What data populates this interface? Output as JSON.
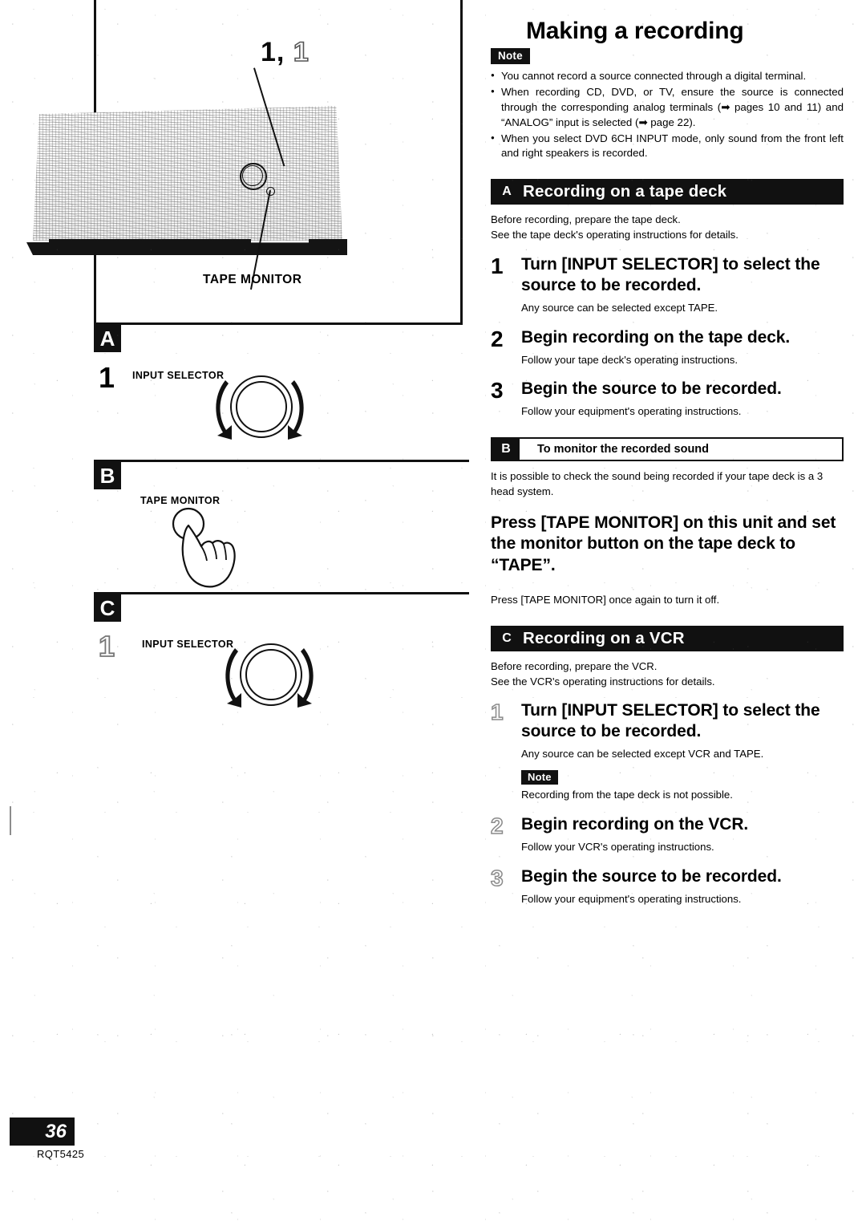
{
  "document": {
    "title": "Making a recording",
    "page_number": "36",
    "doc_code": "RQT5425"
  },
  "illustration": {
    "callout_step_solid": "1,",
    "callout_step_hollow": "1",
    "knob_caption": "TAPE MONITOR"
  },
  "left_diagrams": [
    {
      "badge": "A",
      "step_number": "1",
      "step_style": "solid",
      "control_label": "INPUT SELECTOR",
      "control_type": "rotary-knob"
    },
    {
      "badge": "B",
      "step_number": "",
      "step_style": "none",
      "control_label": "TAPE MONITOR",
      "control_type": "push-button-hand"
    },
    {
      "badge": "C",
      "step_number": "1",
      "step_style": "hollow",
      "control_label": "INPUT SELECTOR",
      "control_type": "rotary-knob"
    }
  ],
  "note_top": {
    "badge": "Note",
    "items": [
      "You cannot record a source connected through a digital terminal.",
      "When recording CD, DVD, or TV, ensure the source is connected through the corresponding analog terminals (➡ pages 10 and 11) and “ANALOG” input is selected (➡ page 22).",
      "When you select DVD 6CH INPUT mode, only sound from the front left and right speakers is recorded."
    ]
  },
  "section_a": {
    "letter": "A",
    "title": "Recording on a tape deck",
    "lead": [
      "Before recording, prepare the tape deck.",
      "See the tape deck's operating instructions for details."
    ],
    "steps": [
      {
        "num": "1",
        "style": "solid",
        "head": "Turn [INPUT SELECTOR] to select the source to be recorded.",
        "sub": "Any source can be selected except TAPE."
      },
      {
        "num": "2",
        "style": "solid",
        "head": "Begin recording on the tape deck.",
        "sub": "Follow your tape deck's operating instructions."
      },
      {
        "num": "3",
        "style": "solid",
        "head": "Begin the source to be recorded.",
        "sub": "Follow your equipment's operating instructions."
      }
    ]
  },
  "section_b": {
    "letter": "B",
    "title": "To monitor the recorded sound",
    "lead": "It is possible to check the sound being recorded if your tape deck is a 3 head system.",
    "instruction": "Press [TAPE MONITOR] on this unit and set the monitor button on the tape deck to “TAPE”.",
    "footer": "Press [TAPE MONITOR] once again to turn it off."
  },
  "section_c": {
    "letter": "C",
    "title": "Recording on a VCR",
    "lead": [
      "Before recording, prepare the VCR.",
      "See the VCR's operating instructions for details."
    ],
    "steps": [
      {
        "num": "1",
        "style": "hollow",
        "head": "Turn [INPUT SELECTOR] to select the source to be recorded.",
        "sub": "Any source can be selected except VCR and TAPE.",
        "note_badge": "Note",
        "note_text": "Recording from the tape deck is not possible."
      },
      {
        "num": "2",
        "style": "hollow",
        "head": "Begin recording on the VCR.",
        "sub": "Follow your VCR's operating instructions."
      },
      {
        "num": "3",
        "style": "hollow",
        "head": "Begin the source to be recorded.",
        "sub": "Follow your equipment's operating instructions."
      }
    ]
  }
}
